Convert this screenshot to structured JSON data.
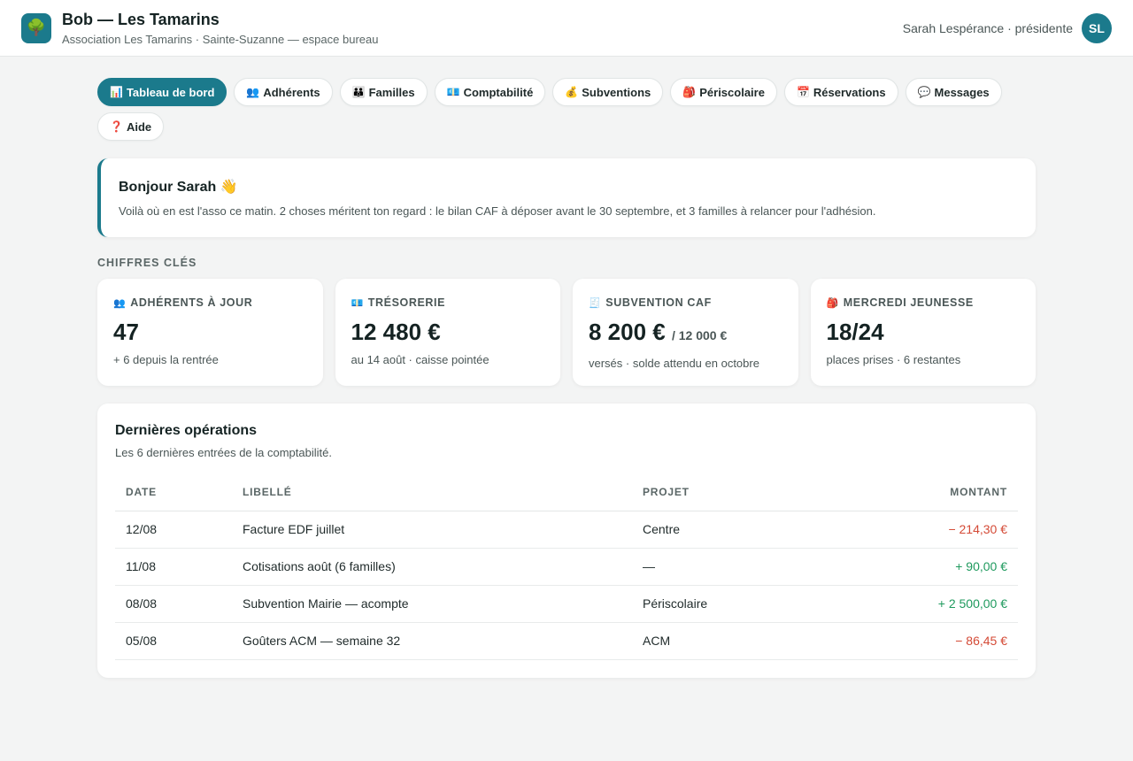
{
  "header": {
    "logo_icon": "🌳",
    "title": "Bob — Les Tamarins",
    "subtitle": "Association Les Tamarins · Sainte-Suzanne — espace bureau",
    "user_name": "Sarah Lespérance · présidente",
    "avatar_initials": "SL"
  },
  "tabs": [
    {
      "icon": "📊",
      "label": "Tableau de bord",
      "active": true
    },
    {
      "icon": "👥",
      "label": "Adhérents"
    },
    {
      "icon": "👪",
      "label": "Familles"
    },
    {
      "icon": "💶",
      "label": "Comptabilité"
    },
    {
      "icon": "💰",
      "label": "Subventions"
    },
    {
      "icon": "🎒",
      "label": "Périscolaire"
    },
    {
      "icon": "📅",
      "label": "Réservations"
    },
    {
      "icon": "💬",
      "label": "Messages"
    },
    {
      "icon": "❓",
      "label": "Aide"
    }
  ],
  "welcome": {
    "title": "Bonjour Sarah 👋",
    "text": "Voilà où en est l'asso ce matin. 2 choses méritent ton regard : le bilan CAF à déposer avant le 30 septembre, et 3 familles à relancer pour l'adhésion."
  },
  "kpi_section_label": "CHIFFRES CLÉS",
  "kpis": [
    {
      "icon": "👥",
      "label": "ADHÉRENTS À JOUR",
      "value": "47",
      "suffix": "",
      "note": "+ 6 depuis la rentrée"
    },
    {
      "icon": "💶",
      "label": "TRÉSORERIE",
      "value": "12 480 €",
      "suffix": "",
      "note": "au 14 août · caisse pointée"
    },
    {
      "icon": "🧾",
      "label": "SUBVENTION CAF",
      "value": "8 200 €",
      "suffix": "/ 12 000 €",
      "note": "versés · solde attendu en octobre"
    },
    {
      "icon": "🎒",
      "label": "MERCREDI JEUNESSE",
      "value": "18/24",
      "suffix": "",
      "note": "places prises · 6 restantes"
    }
  ],
  "operations": {
    "title": "Dernières opérations",
    "subtitle": "Les 6 dernières entrées de la comptabilité.",
    "columns": {
      "date": "DATE",
      "label": "LIBELLÉ",
      "project": "PROJET",
      "amount": "MONTANT"
    },
    "rows": [
      {
        "date": "12/08",
        "label": "Facture EDF juillet",
        "project": "Centre",
        "amount": "− 214,30 €",
        "sign": "neg"
      },
      {
        "date": "11/08",
        "label": "Cotisations août (6 familles)",
        "project": "—",
        "amount": "+ 90,00 €",
        "sign": "pos"
      },
      {
        "date": "08/08",
        "label": "Subvention Mairie — acompte",
        "project": "Périscolaire",
        "amount": "+ 2 500,00 €",
        "sign": "pos"
      },
      {
        "date": "05/08",
        "label": "Goûters ACM — semaine 32",
        "project": "ACM",
        "amount": "− 86,45 €",
        "sign": "neg"
      }
    ]
  },
  "colors": {
    "accent": "#1b7a8c",
    "negative": "#d44a36",
    "positive": "#1f9a5e"
  }
}
